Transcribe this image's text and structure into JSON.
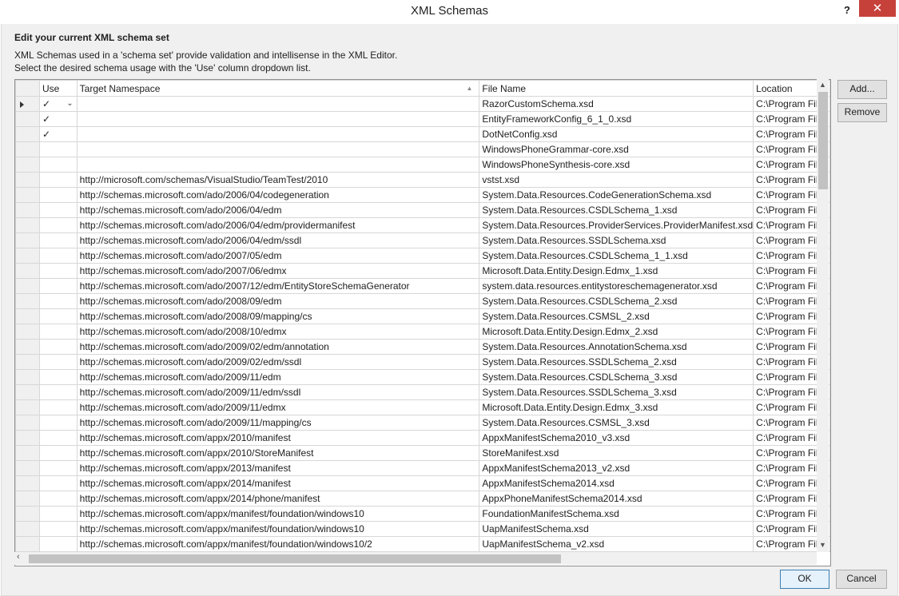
{
  "window": {
    "title": "XML Schemas",
    "help_label": "?",
    "close_label": "✕"
  },
  "heading": "Edit your current XML schema set",
  "description": [
    "XML Schemas used in a 'schema set' provide validation and intellisense in the XML Editor.",
    "Select the desired schema usage with the 'Use' column dropdown list."
  ],
  "columns": {
    "use": "Use",
    "namespace": "Target Namespace",
    "file": "File Name",
    "location": "Location"
  },
  "rows": [
    {
      "use": "✓",
      "ns": "",
      "file": "RazorCustomSchema.xsd",
      "loc": "C:\\Program Files"
    },
    {
      "use": "✓",
      "ns": "",
      "file": "EntityFrameworkConfig_6_1_0.xsd",
      "loc": "C:\\Program Files"
    },
    {
      "use": "✓",
      "ns": "",
      "file": "DotNetConfig.xsd",
      "loc": "C:\\Program Files"
    },
    {
      "use": "",
      "ns": "",
      "file": "WindowsPhoneGrammar-core.xsd",
      "loc": "C:\\Program Files"
    },
    {
      "use": "",
      "ns": "",
      "file": "WindowsPhoneSynthesis-core.xsd",
      "loc": "C:\\Program Files"
    },
    {
      "use": "",
      "ns": "http://microsoft.com/schemas/VisualStudio/TeamTest/2010",
      "file": "vstst.xsd",
      "loc": "C:\\Program Files"
    },
    {
      "use": "",
      "ns": "http://schemas.microsoft.com/ado/2006/04/codegeneration",
      "file": "System.Data.Resources.CodeGenerationSchema.xsd",
      "loc": "C:\\Program Files"
    },
    {
      "use": "",
      "ns": "http://schemas.microsoft.com/ado/2006/04/edm",
      "file": "System.Data.Resources.CSDLSchema_1.xsd",
      "loc": "C:\\Program Files"
    },
    {
      "use": "",
      "ns": "http://schemas.microsoft.com/ado/2006/04/edm/providermanifest",
      "file": "System.Data.Resources.ProviderServices.ProviderManifest.xsd",
      "loc": "C:\\Program Files"
    },
    {
      "use": "",
      "ns": "http://schemas.microsoft.com/ado/2006/04/edm/ssdl",
      "file": "System.Data.Resources.SSDLSchema.xsd",
      "loc": "C:\\Program Files"
    },
    {
      "use": "",
      "ns": "http://schemas.microsoft.com/ado/2007/05/edm",
      "file": "System.Data.Resources.CSDLSchema_1_1.xsd",
      "loc": "C:\\Program Files"
    },
    {
      "use": "",
      "ns": "http://schemas.microsoft.com/ado/2007/06/edmx",
      "file": "Microsoft.Data.Entity.Design.Edmx_1.xsd",
      "loc": "C:\\Program Files"
    },
    {
      "use": "",
      "ns": "http://schemas.microsoft.com/ado/2007/12/edm/EntityStoreSchemaGenerator",
      "file": "system.data.resources.entitystoreschemagenerator.xsd",
      "loc": "C:\\Program Files"
    },
    {
      "use": "",
      "ns": "http://schemas.microsoft.com/ado/2008/09/edm",
      "file": "System.Data.Resources.CSDLSchema_2.xsd",
      "loc": "C:\\Program Files"
    },
    {
      "use": "",
      "ns": "http://schemas.microsoft.com/ado/2008/09/mapping/cs",
      "file": "System.Data.Resources.CSMSL_2.xsd",
      "loc": "C:\\Program Files"
    },
    {
      "use": "",
      "ns": "http://schemas.microsoft.com/ado/2008/10/edmx",
      "file": "Microsoft.Data.Entity.Design.Edmx_2.xsd",
      "loc": "C:\\Program Files"
    },
    {
      "use": "",
      "ns": "http://schemas.microsoft.com/ado/2009/02/edm/annotation",
      "file": "System.Data.Resources.AnnotationSchema.xsd",
      "loc": "C:\\Program Files"
    },
    {
      "use": "",
      "ns": "http://schemas.microsoft.com/ado/2009/02/edm/ssdl",
      "file": "System.Data.Resources.SSDLSchema_2.xsd",
      "loc": "C:\\Program Files"
    },
    {
      "use": "",
      "ns": "http://schemas.microsoft.com/ado/2009/11/edm",
      "file": "System.Data.Resources.CSDLSchema_3.xsd",
      "loc": "C:\\Program Files"
    },
    {
      "use": "",
      "ns": "http://schemas.microsoft.com/ado/2009/11/edm/ssdl",
      "file": "System.Data.Resources.SSDLSchema_3.xsd",
      "loc": "C:\\Program Files"
    },
    {
      "use": "",
      "ns": "http://schemas.microsoft.com/ado/2009/11/edmx",
      "file": "Microsoft.Data.Entity.Design.Edmx_3.xsd",
      "loc": "C:\\Program Files"
    },
    {
      "use": "",
      "ns": "http://schemas.microsoft.com/ado/2009/11/mapping/cs",
      "file": "System.Data.Resources.CSMSL_3.xsd",
      "loc": "C:\\Program Files"
    },
    {
      "use": "",
      "ns": "http://schemas.microsoft.com/appx/2010/manifest",
      "file": "AppxManifestSchema2010_v3.xsd",
      "loc": "C:\\Program Files"
    },
    {
      "use": "",
      "ns": "http://schemas.microsoft.com/appx/2010/StoreManifest",
      "file": "StoreManifest.xsd",
      "loc": "C:\\Program Files"
    },
    {
      "use": "",
      "ns": "http://schemas.microsoft.com/appx/2013/manifest",
      "file": "AppxManifestSchema2013_v2.xsd",
      "loc": "C:\\Program Files"
    },
    {
      "use": "",
      "ns": "http://schemas.microsoft.com/appx/2014/manifest",
      "file": "AppxManifestSchema2014.xsd",
      "loc": "C:\\Program Files"
    },
    {
      "use": "",
      "ns": "http://schemas.microsoft.com/appx/2014/phone/manifest",
      "file": "AppxPhoneManifestSchema2014.xsd",
      "loc": "C:\\Program Files"
    },
    {
      "use": "",
      "ns": "http://schemas.microsoft.com/appx/manifest/foundation/windows10",
      "file": "FoundationManifestSchema.xsd",
      "loc": "C:\\Program Files"
    },
    {
      "use": "",
      "ns": "http://schemas.microsoft.com/appx/manifest/foundation/windows10",
      "file": "UapManifestSchema.xsd",
      "loc": "C:\\Program Files"
    },
    {
      "use": "",
      "ns": "http://schemas.microsoft.com/appx/manifest/foundation/windows10/2",
      "file": "UapManifestSchema_v2.xsd",
      "loc": "C:\\Program Files"
    }
  ],
  "buttons": {
    "add": "Add...",
    "remove": "Remove",
    "ok": "OK",
    "cancel": "Cancel"
  }
}
